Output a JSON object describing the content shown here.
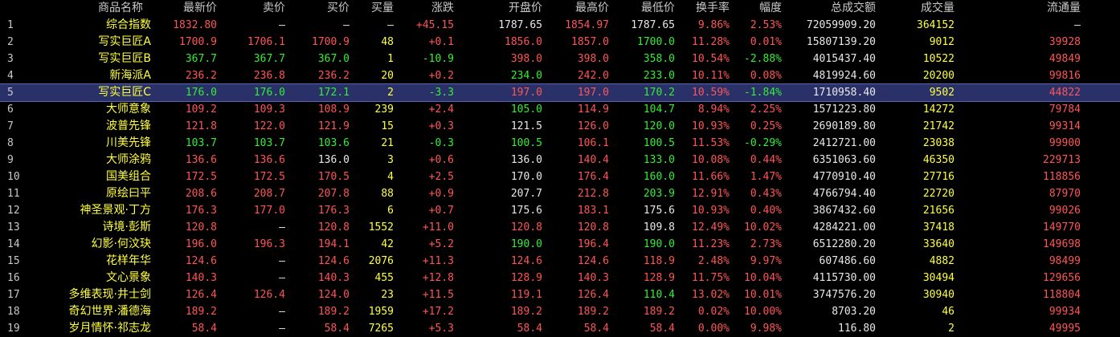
{
  "columns": [
    "商品名称",
    "最新价",
    "卖价",
    "买价",
    "买量",
    "涨跌",
    "开盘价",
    "最高价",
    "最低价",
    "换手率",
    "幅度",
    "总成交额",
    "成交量",
    "流通量"
  ],
  "selected_row": 5,
  "colors": {
    "up": "#ff5555",
    "down": "#33ee33",
    "flat": "#e8e8e8",
    "name": "#ffff3c",
    "selection": "#2a3169"
  },
  "rows": [
    {
      "idx": "1",
      "name": "综合指数",
      "price": "1832.80",
      "ask": "—",
      "bid": "—",
      "bid_vol": "—",
      "chg": "+45.15",
      "open": "1787.65",
      "high": "1854.97",
      "low": "1787.65",
      "turnover": "9.86%",
      "amp": "2.53%",
      "amount": "72059909.20",
      "volume": "364152",
      "float": "—",
      "cls": {
        "price": "red",
        "ask": "wht",
        "bid": "wht",
        "bid_vol": "wht",
        "chg": "red",
        "open": "wht",
        "high": "red",
        "low": "wht",
        "amp": "red",
        "float": "wht"
      }
    },
    {
      "idx": "2",
      "name": "写实巨匠A",
      "price": "1700.9",
      "ask": "1706.1",
      "bid": "1700.9",
      "bid_vol": "48",
      "chg": "+0.1",
      "open": "1856.0",
      "high": "1857.0",
      "low": "1700.0",
      "turnover": "11.28%",
      "amp": "0.01%",
      "amount": "15807139.20",
      "volume": "9012",
      "float": "39928",
      "cls": {
        "price": "red",
        "ask": "red",
        "bid": "red",
        "bid_vol": "yel",
        "chg": "red",
        "open": "red",
        "high": "red",
        "low": "grn",
        "amp": "red",
        "float": "red"
      }
    },
    {
      "idx": "3",
      "name": "写实巨匠B",
      "price": "367.7",
      "ask": "367.7",
      "bid": "367.0",
      "bid_vol": "1",
      "chg": "-10.9",
      "open": "398.0",
      "high": "398.0",
      "low": "358.0",
      "turnover": "10.54%",
      "amp": "-2.88%",
      "amount": "4015437.40",
      "volume": "10522",
      "float": "49849",
      "cls": {
        "price": "grn",
        "ask": "grn",
        "bid": "grn",
        "bid_vol": "yel",
        "chg": "grn",
        "open": "red",
        "high": "red",
        "low": "grn",
        "amp": "grn",
        "float": "red"
      }
    },
    {
      "idx": "4",
      "name": "新海派A",
      "price": "236.2",
      "ask": "236.8",
      "bid": "236.2",
      "bid_vol": "20",
      "chg": "+0.2",
      "open": "234.0",
      "high": "242.0",
      "low": "233.0",
      "turnover": "10.11%",
      "amp": "0.08%",
      "amount": "4819924.60",
      "volume": "20200",
      "float": "99816",
      "cls": {
        "price": "red",
        "ask": "red",
        "bid": "red",
        "bid_vol": "yel",
        "chg": "red",
        "open": "grn",
        "high": "red",
        "low": "grn",
        "amp": "red",
        "float": "red"
      }
    },
    {
      "idx": "5",
      "name": "写实巨匠C",
      "price": "176.0",
      "ask": "176.0",
      "bid": "172.1",
      "bid_vol": "2",
      "chg": "-3.3",
      "open": "197.0",
      "high": "197.0",
      "low": "170.2",
      "turnover": "10.59%",
      "amp": "-1.84%",
      "amount": "1710958.40",
      "volume": "9502",
      "float": "44822",
      "cls": {
        "price": "grn",
        "ask": "grn",
        "bid": "grn",
        "bid_vol": "yel",
        "chg": "grn",
        "open": "red",
        "high": "red",
        "low": "grn",
        "amp": "grn",
        "float": "red"
      }
    },
    {
      "idx": "6",
      "name": "大师意象",
      "price": "109.2",
      "ask": "109.3",
      "bid": "108.9",
      "bid_vol": "239",
      "chg": "+2.4",
      "open": "105.0",
      "high": "114.9",
      "low": "104.7",
      "turnover": "8.94%",
      "amp": "2.25%",
      "amount": "1571223.80",
      "volume": "14272",
      "float": "79784",
      "cls": {
        "price": "red",
        "ask": "red",
        "bid": "red",
        "bid_vol": "yel",
        "chg": "red",
        "open": "grn",
        "high": "red",
        "low": "grn",
        "amp": "red",
        "float": "red"
      }
    },
    {
      "idx": "7",
      "name": "波普先锋",
      "price": "121.8",
      "ask": "122.0",
      "bid": "121.9",
      "bid_vol": "15",
      "chg": "+0.3",
      "open": "121.5",
      "high": "126.0",
      "low": "120.0",
      "turnover": "10.93%",
      "amp": "0.25%",
      "amount": "2690189.80",
      "volume": "21742",
      "float": "99314",
      "cls": {
        "price": "red",
        "ask": "red",
        "bid": "red",
        "bid_vol": "yel",
        "chg": "red",
        "open": "wht",
        "high": "red",
        "low": "grn",
        "amp": "red",
        "float": "red"
      }
    },
    {
      "idx": "8",
      "name": "川美先锋",
      "price": "103.7",
      "ask": "103.7",
      "bid": "103.6",
      "bid_vol": "21",
      "chg": "-0.3",
      "open": "100.5",
      "high": "106.1",
      "low": "100.5",
      "turnover": "11.53%",
      "amp": "-0.29%",
      "amount": "2412721.00",
      "volume": "23038",
      "float": "99900",
      "cls": {
        "price": "grn",
        "ask": "grn",
        "bid": "grn",
        "bid_vol": "yel",
        "chg": "grn",
        "open": "grn",
        "high": "red",
        "low": "grn",
        "amp": "grn",
        "float": "red"
      }
    },
    {
      "idx": "9",
      "name": "大师涂鸦",
      "price": "136.6",
      "ask": "136.6",
      "bid": "136.0",
      "bid_vol": "3",
      "chg": "+0.6",
      "open": "136.0",
      "high": "140.4",
      "low": "133.0",
      "turnover": "10.08%",
      "amp": "0.44%",
      "amount": "6351063.60",
      "volume": "46350",
      "float": "229713",
      "cls": {
        "price": "red",
        "ask": "red",
        "bid": "wht",
        "bid_vol": "yel",
        "chg": "red",
        "open": "wht",
        "high": "red",
        "low": "grn",
        "amp": "red",
        "float": "red"
      }
    },
    {
      "idx": "10",
      "name": "国美组合",
      "price": "172.5",
      "ask": "172.5",
      "bid": "170.5",
      "bid_vol": "4",
      "chg": "+2.5",
      "open": "170.0",
      "high": "176.4",
      "low": "160.0",
      "turnover": "11.66%",
      "amp": "1.47%",
      "amount": "4770910.40",
      "volume": "27716",
      "float": "118856",
      "cls": {
        "price": "red",
        "ask": "red",
        "bid": "red",
        "bid_vol": "yel",
        "chg": "red",
        "open": "wht",
        "high": "red",
        "low": "grn",
        "amp": "red",
        "float": "red"
      }
    },
    {
      "idx": "11",
      "name": "原绘曰平",
      "price": "208.6",
      "ask": "208.7",
      "bid": "207.8",
      "bid_vol": "88",
      "chg": "+0.9",
      "open": "207.7",
      "high": "212.8",
      "low": "203.9",
      "turnover": "12.91%",
      "amp": "0.43%",
      "amount": "4766794.40",
      "volume": "22720",
      "float": "87970",
      "cls": {
        "price": "red",
        "ask": "red",
        "bid": "red",
        "bid_vol": "yel",
        "chg": "red",
        "open": "wht",
        "high": "red",
        "low": "grn",
        "amp": "red",
        "float": "red"
      }
    },
    {
      "idx": "12",
      "name": "神圣景观·丁方",
      "price": "176.3",
      "ask": "177.0",
      "bid": "176.3",
      "bid_vol": "6",
      "chg": "+0.7",
      "open": "175.6",
      "high": "183.1",
      "low": "175.6",
      "turnover": "10.93%",
      "amp": "0.40%",
      "amount": "3867432.60",
      "volume": "21656",
      "float": "99026",
      "cls": {
        "price": "red",
        "ask": "red",
        "bid": "red",
        "bid_vol": "yel",
        "chg": "red",
        "open": "wht",
        "high": "red",
        "low": "wht",
        "amp": "red",
        "float": "red"
      }
    },
    {
      "idx": "13",
      "name": "诗境·彭斯",
      "price": "120.8",
      "ask": "—",
      "bid": "120.8",
      "bid_vol": "1552",
      "chg": "+11.0",
      "open": "120.8",
      "high": "120.8",
      "low": "109.8",
      "turnover": "12.49%",
      "amp": "10.02%",
      "amount": "4284221.00",
      "volume": "37418",
      "float": "149770",
      "cls": {
        "price": "red",
        "ask": "wht",
        "bid": "red",
        "bid_vol": "yel",
        "chg": "red",
        "open": "red",
        "high": "red",
        "low": "wht",
        "amp": "red",
        "float": "red"
      }
    },
    {
      "idx": "14",
      "name": "幻影·何汶玦",
      "price": "196.0",
      "ask": "196.3",
      "bid": "194.1",
      "bid_vol": "42",
      "chg": "+5.2",
      "open": "190.0",
      "high": "196.4",
      "low": "190.0",
      "turnover": "11.23%",
      "amp": "2.73%",
      "amount": "6512280.20",
      "volume": "33640",
      "float": "149698",
      "cls": {
        "price": "red",
        "ask": "red",
        "bid": "red",
        "bid_vol": "yel",
        "chg": "red",
        "open": "grn",
        "high": "red",
        "low": "grn",
        "amp": "red",
        "float": "red"
      }
    },
    {
      "idx": "15",
      "name": "花样年华",
      "price": "124.6",
      "ask": "—",
      "bid": "124.6",
      "bid_vol": "2076",
      "chg": "+11.3",
      "open": "124.6",
      "high": "124.6",
      "low": "118.9",
      "turnover": "2.48%",
      "amp": "9.97%",
      "amount": "607486.60",
      "volume": "4882",
      "float": "98499",
      "cls": {
        "price": "red",
        "ask": "wht",
        "bid": "red",
        "bid_vol": "yel",
        "chg": "red",
        "open": "red",
        "high": "red",
        "low": "red",
        "amp": "red",
        "float": "red"
      }
    },
    {
      "idx": "16",
      "name": "文心景象",
      "price": "140.3",
      "ask": "—",
      "bid": "140.3",
      "bid_vol": "455",
      "chg": "+12.8",
      "open": "128.9",
      "high": "140.3",
      "low": "128.9",
      "turnover": "11.75%",
      "amp": "10.04%",
      "amount": "4115730.00",
      "volume": "30494",
      "float": "129656",
      "cls": {
        "price": "red",
        "ask": "wht",
        "bid": "red",
        "bid_vol": "yel",
        "chg": "red",
        "open": "red",
        "high": "red",
        "low": "red",
        "amp": "red",
        "float": "red"
      }
    },
    {
      "idx": "17",
      "name": "多维表现·井士剑",
      "price": "126.4",
      "ask": "126.4",
      "bid": "124.0",
      "bid_vol": "23",
      "chg": "+11.5",
      "open": "119.1",
      "high": "126.4",
      "low": "110.4",
      "turnover": "13.02%",
      "amp": "10.01%",
      "amount": "3747576.20",
      "volume": "30940",
      "float": "118804",
      "cls": {
        "price": "red",
        "ask": "red",
        "bid": "red",
        "bid_vol": "yel",
        "chg": "red",
        "open": "red",
        "high": "red",
        "low": "grn",
        "amp": "red",
        "float": "red"
      }
    },
    {
      "idx": "18",
      "name": "奇幻世界·潘德海",
      "price": "189.2",
      "ask": "—",
      "bid": "189.2",
      "bid_vol": "1959",
      "chg": "+17.2",
      "open": "189.2",
      "high": "189.2",
      "low": "189.2",
      "turnover": "0.02%",
      "amp": "10.00%",
      "amount": "8703.20",
      "volume": "46",
      "float": "99934",
      "cls": {
        "price": "red",
        "ask": "wht",
        "bid": "red",
        "bid_vol": "yel",
        "chg": "red",
        "open": "red",
        "high": "red",
        "low": "red",
        "amp": "red",
        "float": "red"
      }
    },
    {
      "idx": "19",
      "name": "岁月情怀·祁志龙",
      "price": "58.4",
      "ask": "—",
      "bid": "58.4",
      "bid_vol": "7265",
      "chg": "+5.3",
      "open": "58.4",
      "high": "58.4",
      "low": "58.4",
      "turnover": "0.00%",
      "amp": "9.98%",
      "amount": "116.80",
      "volume": "2",
      "float": "49995",
      "cls": {
        "price": "red",
        "ask": "wht",
        "bid": "red",
        "bid_vol": "yel",
        "chg": "red",
        "open": "red",
        "high": "red",
        "low": "red",
        "amp": "red",
        "float": "red"
      }
    }
  ]
}
